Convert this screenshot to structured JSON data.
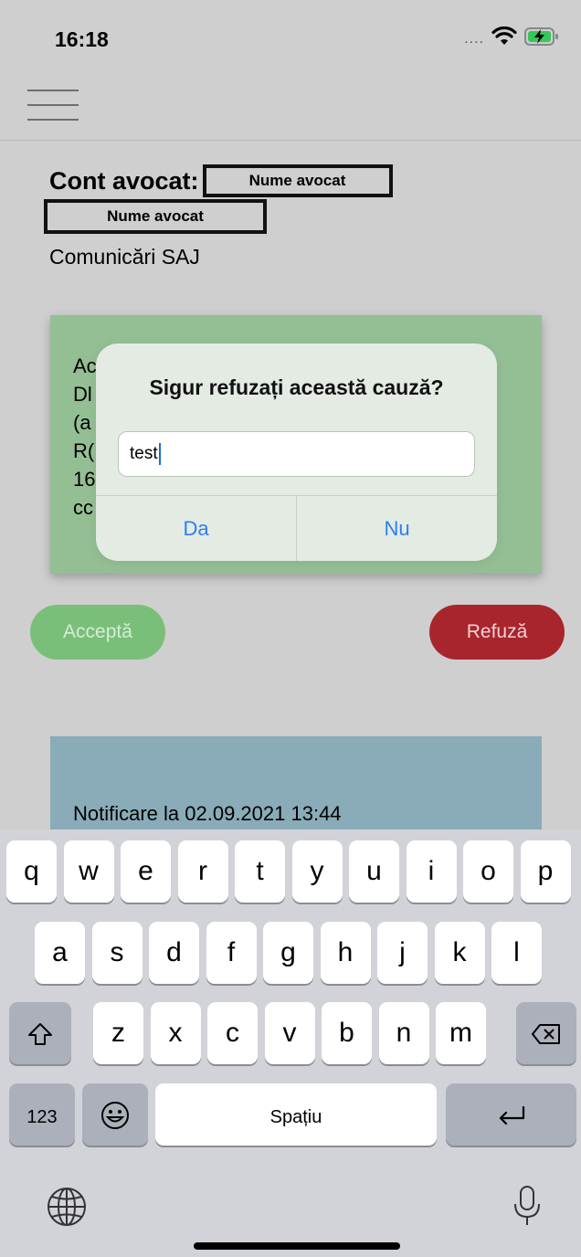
{
  "status_bar": {
    "time": "16:18",
    "signal": "....",
    "wifi_icon": "wifi-icon",
    "battery_icon": "battery-charging-icon"
  },
  "nav": {
    "menu_icon": "hamburger-menu-icon"
  },
  "header": {
    "account_label": "Cont avocat:",
    "lawyer_name_1": "Nume avocat",
    "lawyer_name_2": "Nume avocat",
    "section": "Comunicări SAJ"
  },
  "card_notice": {
    "text": "Ac                                                   4\nDl\n(a\nR(\n16\ncc",
    "background": "#94bf94"
  },
  "actions": {
    "accept_label": "Acceptă",
    "refuse_label": "Refuză",
    "accept_color": "#79bf79",
    "refuse_color": "#a8252e"
  },
  "card_notification": {
    "text": "Notificare la 02.09.2021 13:44",
    "background": "#8aabb8"
  },
  "alert": {
    "title": "Sigur refuzați această cauză?",
    "input_value": "test",
    "confirm_label": "Da",
    "cancel_label": "Nu",
    "button_color": "#2f7df0"
  },
  "keyboard": {
    "row1": [
      "q",
      "w",
      "e",
      "r",
      "t",
      "y",
      "u",
      "i",
      "o",
      "p"
    ],
    "row2": [
      "a",
      "s",
      "d",
      "f",
      "g",
      "h",
      "j",
      "k",
      "l"
    ],
    "row3": [
      "z",
      "x",
      "c",
      "v",
      "b",
      "n",
      "m"
    ],
    "shift_icon": "shift-icon",
    "backspace_icon": "backspace-icon",
    "numbers_label": "123",
    "emoji_icon": "emoji-icon",
    "space_label": "Spațiu",
    "return_icon": "return-icon",
    "globe_icon": "globe-icon",
    "mic_icon": "microphone-icon"
  }
}
